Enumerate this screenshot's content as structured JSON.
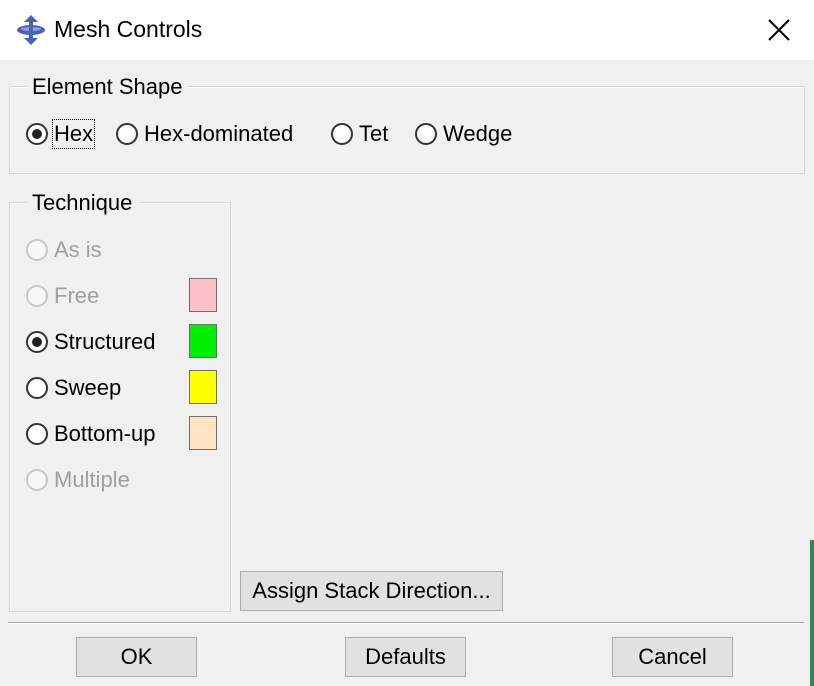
{
  "window": {
    "title": "Mesh Controls",
    "icon": "abaqus-app-icon",
    "close_icon": "close-icon"
  },
  "element_shape": {
    "title": "Element Shape",
    "options": [
      {
        "label": "Hex",
        "checked": true
      },
      {
        "label": "Hex-dominated",
        "checked": false
      },
      {
        "label": "Tet",
        "checked": false
      },
      {
        "label": "Wedge",
        "checked": false
      }
    ]
  },
  "technique": {
    "title": "Technique",
    "options": [
      {
        "label": "As is",
        "checked": false,
        "disabled": true,
        "color": null
      },
      {
        "label": "Free",
        "checked": false,
        "disabled": true,
        "color": "#ffc0cb"
      },
      {
        "label": "Structured",
        "checked": true,
        "disabled": false,
        "color": "#00ee00"
      },
      {
        "label": "Sweep",
        "checked": false,
        "disabled": false,
        "color": "#ffff00"
      },
      {
        "label": "Bottom-up",
        "checked": false,
        "disabled": false,
        "color": "#ffe4c4"
      },
      {
        "label": "Multiple",
        "checked": false,
        "disabled": true,
        "color": null
      }
    ]
  },
  "assign_stack_label": "Assign Stack Direction...",
  "buttons": {
    "ok": "OK",
    "defaults": "Defaults",
    "cancel": "Cancel"
  }
}
